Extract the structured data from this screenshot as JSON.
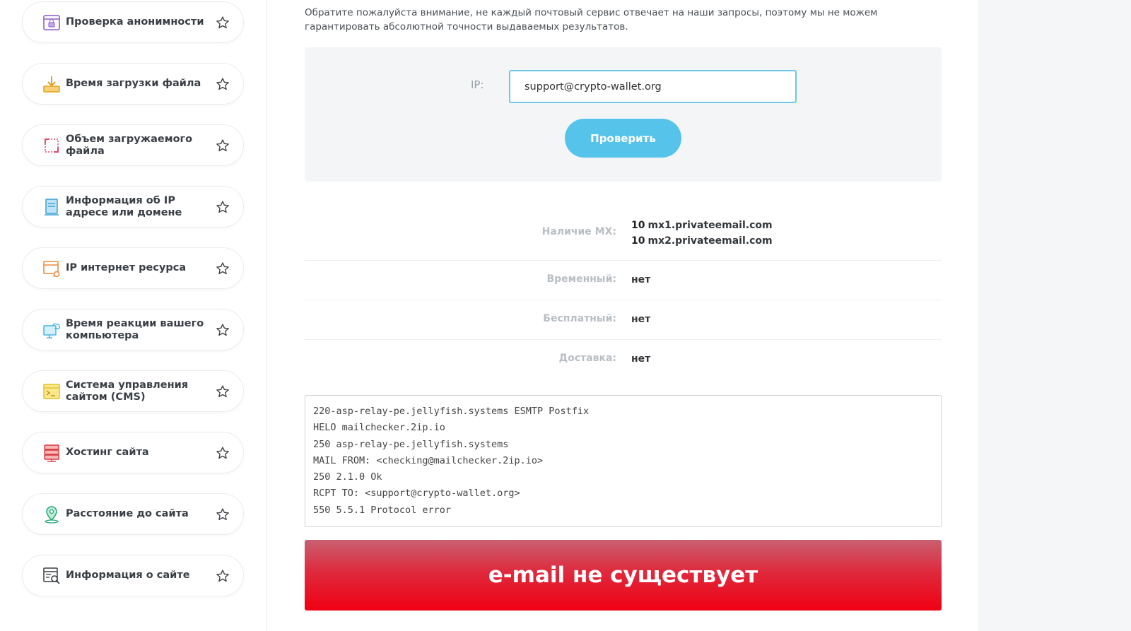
{
  "sidebar": {
    "items": [
      {
        "label": "Проверка анонимности",
        "icon": "lock-icon"
      },
      {
        "label": "Время загрузки файла",
        "icon": "download-icon"
      },
      {
        "label": "Объем загружаемого файла",
        "icon": "resize-icon"
      },
      {
        "label": "Информация об IP адресе или домене",
        "icon": "document-icon"
      },
      {
        "label": "IP интернет ресурса",
        "icon": "browser-link-icon"
      },
      {
        "label": "Время реакции вашего компьютера",
        "icon": "monitor-cloud-icon"
      },
      {
        "label": "Система управления сайтом (CMS)",
        "icon": "terminal-icon"
      },
      {
        "label": "Хостинг сайта",
        "icon": "server-icon"
      },
      {
        "label": "Расстояние до сайта",
        "icon": "location-pin-icon"
      },
      {
        "label": "Информация о сайте",
        "icon": "site-search-icon"
      }
    ]
  },
  "main": {
    "notice": "Обратите пожалуйста внимание, не каждый почтовый сервис отвечает на наши запросы, поэтому мы не можем гарантировать абсолютной точности выдаваемых результатов.",
    "form": {
      "ip_label": "IP:",
      "input_value": "support@crypto-wallet.org",
      "check_button": "Проверить"
    },
    "results": {
      "mx_key": "Наличие MX:",
      "mx_values": [
        {
          "priority": "10",
          "host": "mx1.privateemail.com"
        },
        {
          "priority": "10",
          "host": "mx2.privateemail.com"
        }
      ],
      "temp_key": "Временный:",
      "temp_val": "нет",
      "free_key": "Бесплатный:",
      "free_val": "нет",
      "delivery_key": "Доставка:",
      "delivery_val": "нет"
    },
    "log": [
      "220-asp-relay-pe.jellyfish.systems ESMTP Postfix",
      "HELO mailchecker.2ip.io",
      "250 asp-relay-pe.jellyfish.systems",
      "MAIL FROM: <checking@mailchecker.2ip.io>",
      "250 2.1.0 Ok",
      "RCPT TO: <support@crypto-wallet.org>",
      "550 5.5.1 Protocol error"
    ],
    "result_text": "e-mail не существует"
  },
  "colors": {
    "accent": "#56c3ea",
    "input_border": "#6ec8e6",
    "error": "#f00014"
  }
}
